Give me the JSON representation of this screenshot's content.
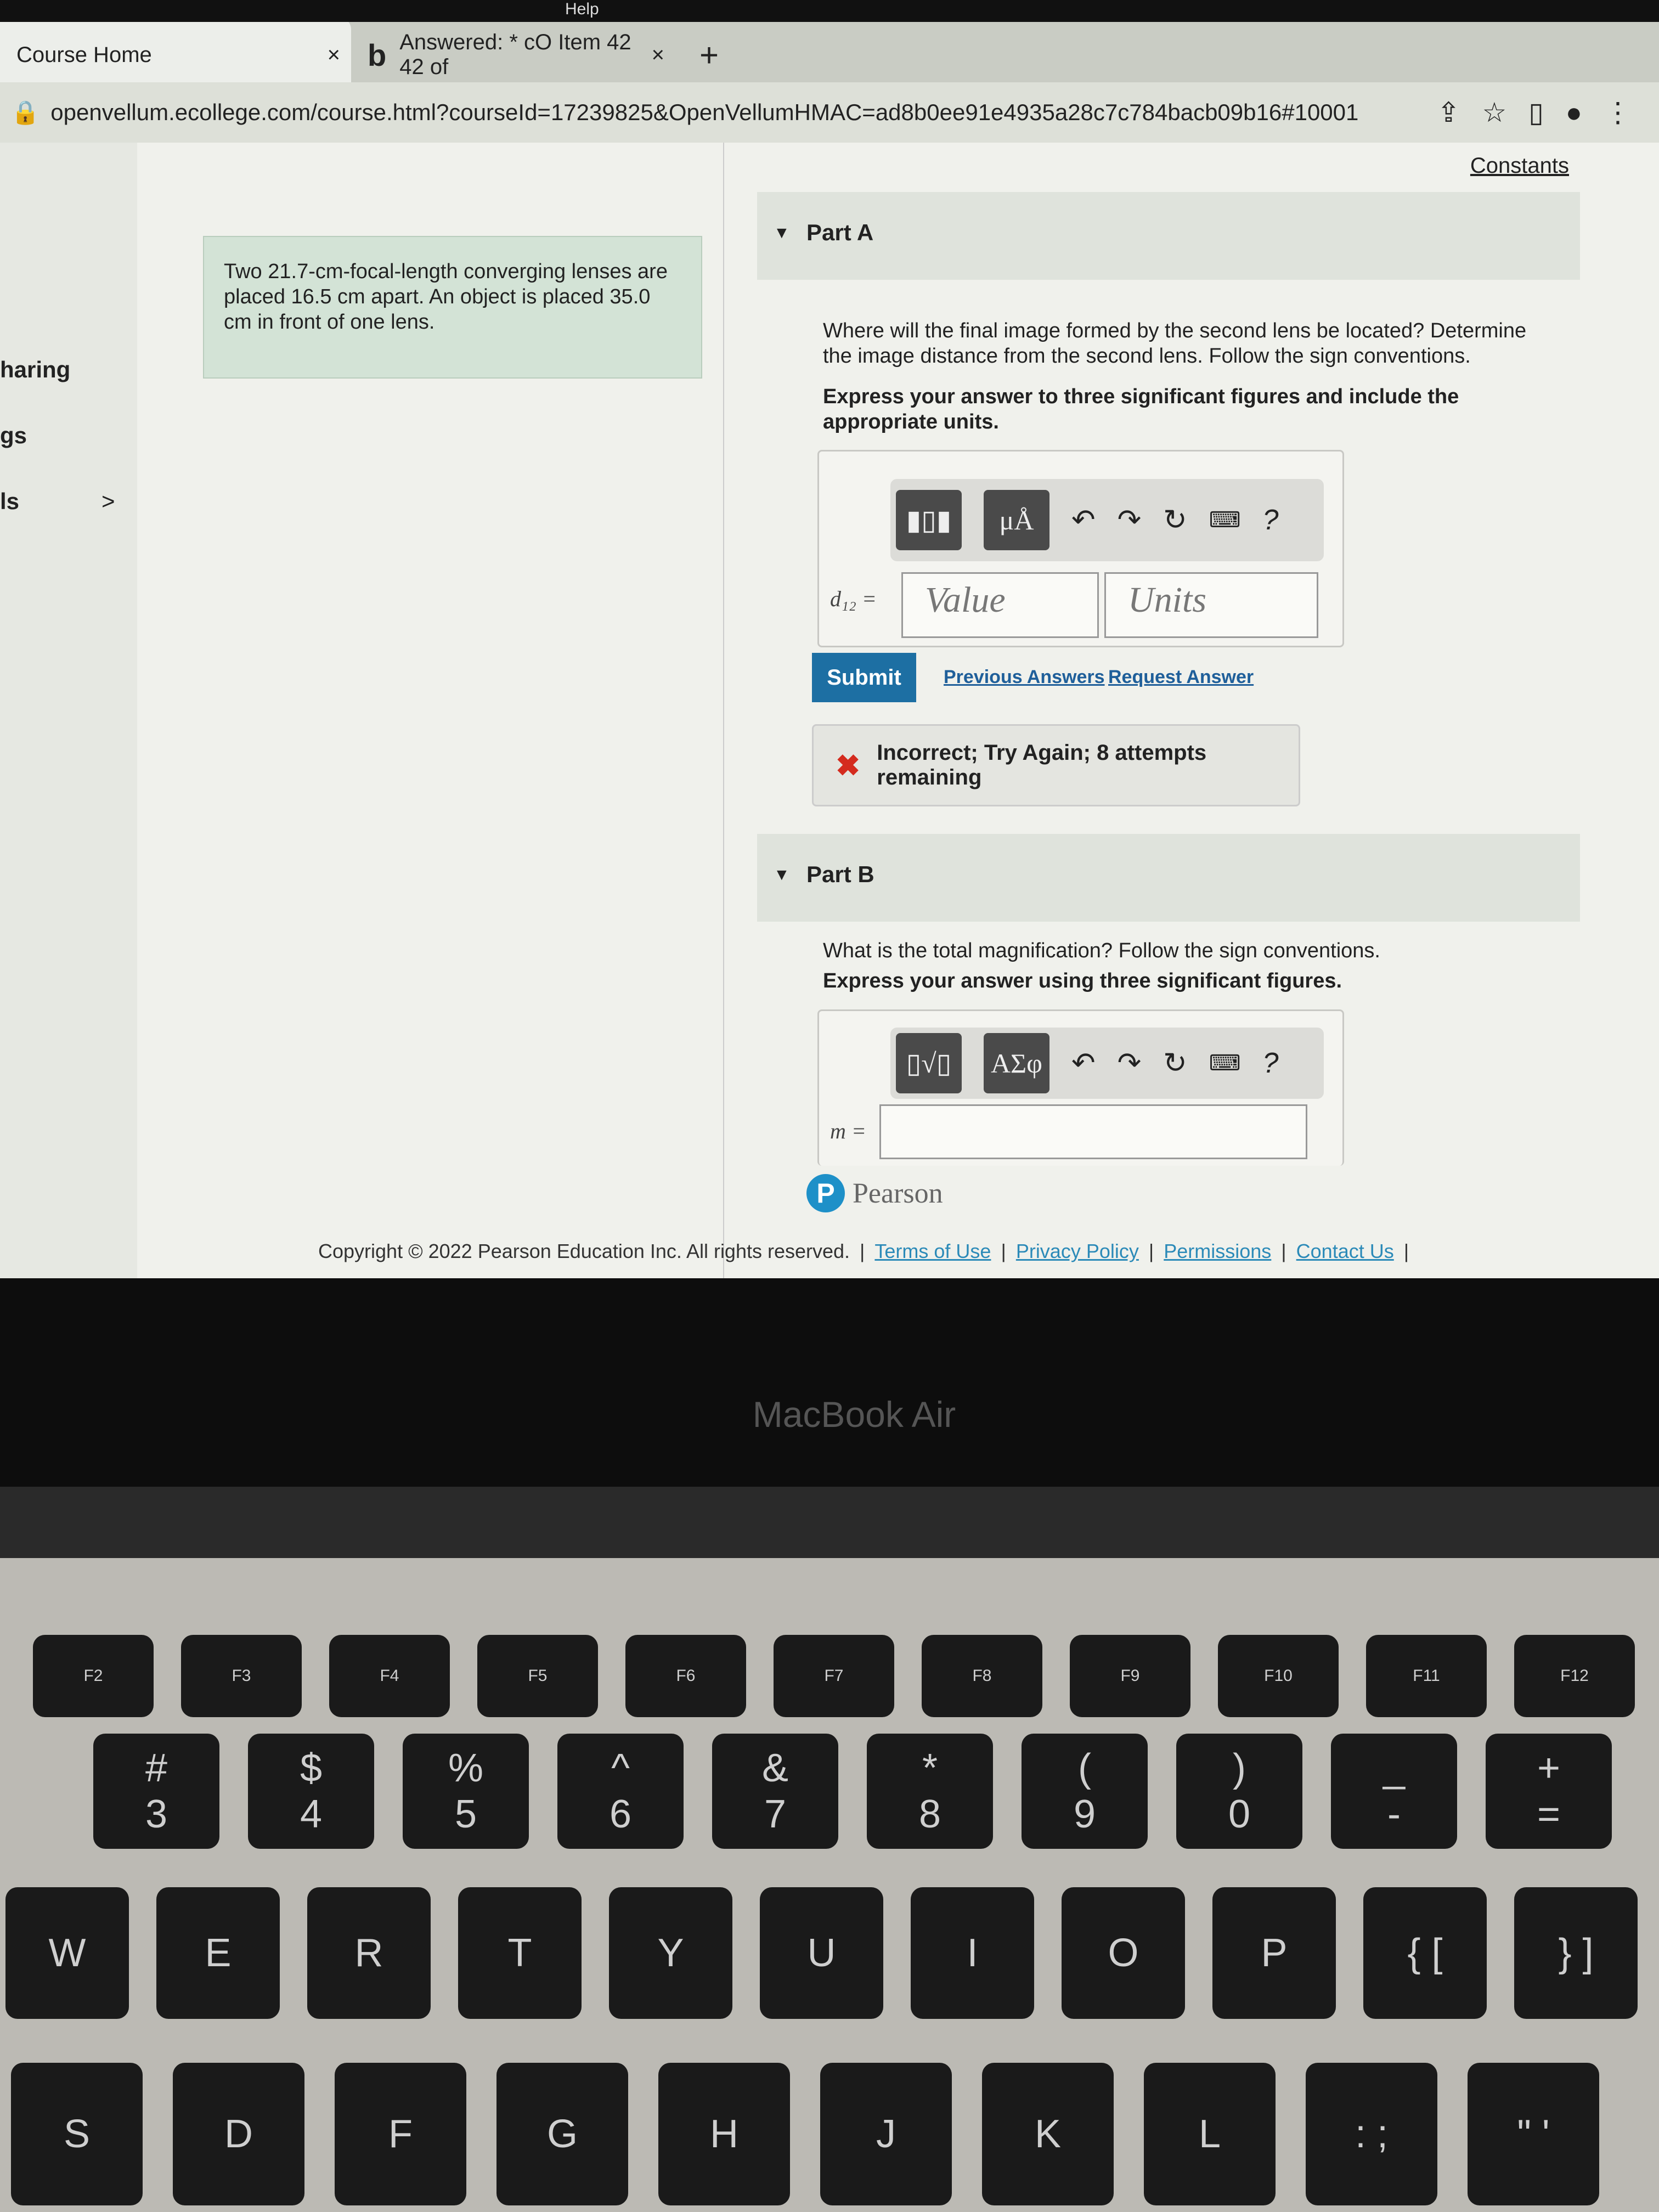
{
  "menubar": {
    "help": "Help"
  },
  "browser": {
    "tabs": [
      {
        "label": "Course Home",
        "close": "×"
      },
      {
        "label": "Answered: * cO Item 42 42 of",
        "favicon": "b",
        "close": "×"
      }
    ],
    "new_tab": "+",
    "url": "openvellum.ecollege.com/course.html?courseId=17239825&OpenVellumHMAC=ad8b0ee91e4935a28c7c784bacb09b16#10001",
    "icons": [
      "lock-icon",
      "share-icon",
      "star-icon",
      "sidebar-icon",
      "profile-icon",
      "menu-icon"
    ]
  },
  "sidebar": {
    "items": [
      {
        "label": "haring"
      },
      {
        "label": "gs"
      },
      {
        "label": "ls",
        "chevron": ">"
      }
    ]
  },
  "problem": {
    "text": "Two 21.7-cm-focal-length converging lenses are placed 16.5 cm apart. An object is placed 35.0 cm in front of one lens."
  },
  "constants": "Constants",
  "partA": {
    "title": "Part A",
    "question": "Where will the final image formed by the second lens be located? Determine the image distance from the second lens. Follow the sign conventions.",
    "instruction": "Express your answer to three significant figures and include the appropriate units.",
    "toolbar": {
      "units_btn": "μÅ",
      "help": "?"
    },
    "var_label": "d₁₂ =",
    "value_placeholder": "Value",
    "units_placeholder": "Units",
    "submit": "Submit",
    "previous_answers": "Previous Answers",
    "request_answer": "Request Answer",
    "feedback": "Incorrect; Try Again; 8 attempts remaining"
  },
  "partB": {
    "title": "Part B",
    "question": "What is the total magnification? Follow the sign conventions.",
    "instruction": "Express your answer using three significant figures.",
    "toolbar": {
      "math_btn": "▯√▯",
      "greek_btn": "ΑΣφ",
      "help": "?"
    },
    "var_label": "m ="
  },
  "pearson": "Pearson",
  "footer": {
    "copyright": "Copyright © 2022 Pearson Education Inc. All rights reserved.",
    "links": [
      "Terms of Use",
      "Privacy Policy",
      "Permissions",
      "Contact Us"
    ]
  },
  "laptop": {
    "brand": "MacBook Air"
  },
  "keyboard": {
    "fn_row": [
      "F2",
      "F3",
      "F4",
      "F5",
      "F6",
      "F7",
      "F8",
      "F9",
      "F10",
      "F11",
      "F12"
    ],
    "number_row": [
      [
        "#",
        "3"
      ],
      [
        "$",
        "4"
      ],
      [
        "%",
        "5"
      ],
      [
        "^",
        "6"
      ],
      [
        "&",
        "7"
      ],
      [
        "*",
        "8"
      ],
      [
        "(",
        "9"
      ],
      [
        ")",
        "0"
      ],
      [
        "_",
        "-"
      ],
      [
        "+",
        "="
      ]
    ],
    "top_row": [
      "W",
      "E",
      "R",
      "T",
      "Y",
      "U",
      "I",
      "O",
      "P",
      "{ [",
      "} ]"
    ],
    "home_row": [
      "S",
      "D",
      "F",
      "G",
      "H",
      "J",
      "K",
      "L",
      ": ;",
      "\" '"
    ]
  }
}
